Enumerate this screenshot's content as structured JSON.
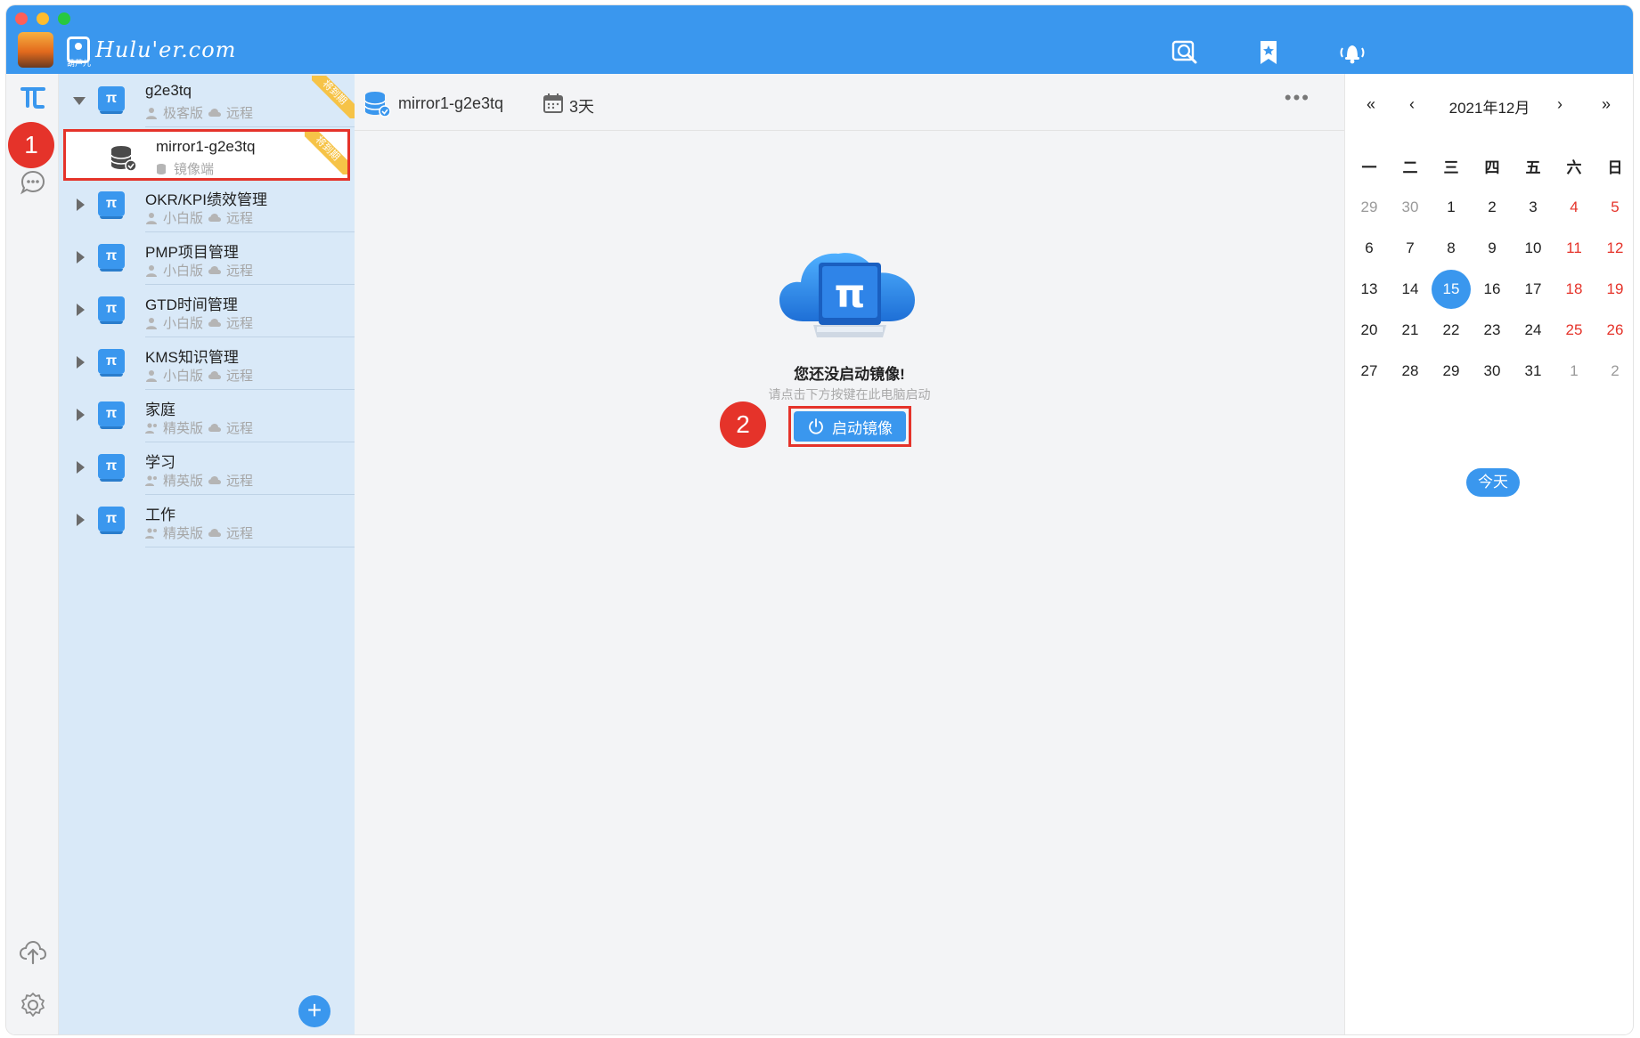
{
  "titlebar": {
    "brand_text": "Hulu'er.com",
    "brand_sub": "葫芦儿",
    "icons": [
      "search-globe-icon",
      "bookmark-star-icon",
      "bell-icon"
    ]
  },
  "rail": {
    "icons": [
      "pi-project-icon",
      "chat-icon",
      "cloud-upload-icon",
      "settings-gear-icon"
    ]
  },
  "tree": {
    "items": [
      {
        "name": "g2e3tq",
        "edition": "极客版",
        "location": "远程",
        "ribbon": "将到期",
        "expanded": true
      },
      {
        "name": "mirror1-g2e3tq",
        "edition": "镜像端",
        "ribbon": "将到期"
      },
      {
        "name": "OKR/KPI绩效管理",
        "edition": "小白版",
        "location": "远程"
      },
      {
        "name": "PMP项目管理",
        "edition": "小白版",
        "location": "远程"
      },
      {
        "name": "GTD时间管理",
        "edition": "小白版",
        "location": "远程"
      },
      {
        "name": "KMS知识管理",
        "edition": "小白版",
        "location": "远程"
      },
      {
        "name": "家庭",
        "edition": "精英版",
        "location": "远程"
      },
      {
        "name": "学习",
        "edition": "精英版",
        "location": "远程"
      },
      {
        "name": "工作",
        "edition": "精英版",
        "location": "远程"
      }
    ],
    "add_label": "+"
  },
  "main": {
    "title": "mirror1-g2e3tq",
    "days": "3天",
    "more": "•••",
    "empty_title": "您还没启动镜像!",
    "empty_sub": "请点击下方按键在此电脑启动",
    "start_button": "启动镜像"
  },
  "badges": {
    "one": "1",
    "two": "2"
  },
  "calendar": {
    "month": "2021年12月",
    "prev_year": "«",
    "prev_month": "‹",
    "next_month": "›",
    "next_year": "»",
    "weekdays": [
      "一",
      "二",
      "三",
      "四",
      "五",
      "六",
      "日"
    ],
    "weeks": [
      [
        "29",
        "30",
        "1",
        "2",
        "3",
        "4",
        "5"
      ],
      [
        "6",
        "7",
        "8",
        "9",
        "10",
        "11",
        "12"
      ],
      [
        "13",
        "14",
        "15",
        "16",
        "17",
        "18",
        "19"
      ],
      [
        "20",
        "21",
        "22",
        "23",
        "24",
        "25",
        "26"
      ],
      [
        "27",
        "28",
        "29",
        "30",
        "31",
        "1",
        "2"
      ]
    ],
    "today": "15",
    "today_button": "今天"
  },
  "colors": {
    "accent": "#3a97ee",
    "highlight": "#e5332a",
    "ribbon": "#f6c347",
    "tree_bg": "#d9e9f8"
  }
}
